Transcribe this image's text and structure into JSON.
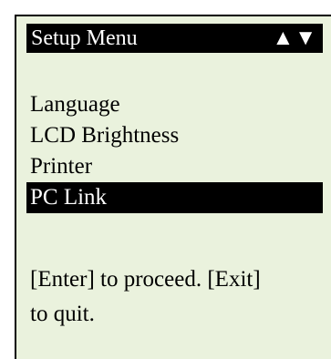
{
  "screen": {
    "title": "Setup Menu",
    "scroll_indicator": "▲▼",
    "menu_items": [
      {
        "label": "Language",
        "selected": false
      },
      {
        "label": "LCD Brightness",
        "selected": false
      },
      {
        "label": "Printer",
        "selected": false
      },
      {
        "label": "PC Link",
        "selected": true
      }
    ],
    "help_line_1": "[Enter] to proceed. [Exit]",
    "help_line_2": "to quit."
  },
  "colors": {
    "screen_background": "#eaf2dd",
    "highlight_background": "#000000",
    "highlight_text": "#ffffff",
    "text": "#000000"
  }
}
